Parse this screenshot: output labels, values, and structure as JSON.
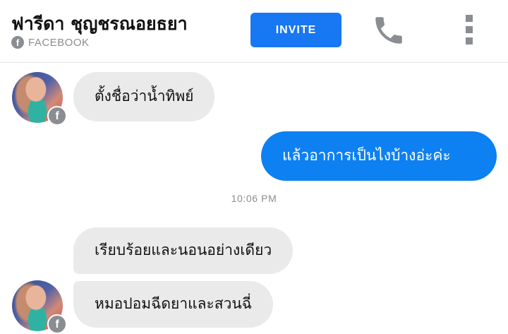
{
  "header": {
    "contact_name": "ฟารีดา ชุญชรณอยธยา",
    "source_label": "FACEBOOK",
    "source_icon": "facebook-icon",
    "invite_label": "INVITE",
    "call_icon": "phone-icon",
    "more_icon": "more-vertical-icon"
  },
  "messages": [
    {
      "direction": "incoming",
      "text": "ตั้งชื่อว่าน้ำทิพย์"
    },
    {
      "direction": "outgoing",
      "text": "แล้วอาการเป็นไงบ้างอ่ะค่ะ"
    },
    {
      "direction": "incoming",
      "text": "เรียบร้อยและนอนอย่างเดียว"
    },
    {
      "direction": "incoming",
      "text": "หมอปอมฉีดยาและสวนฉี่"
    }
  ],
  "timestamp": "10:06 PM",
  "colors": {
    "accent": "#1877f2",
    "outgoing_bubble": "#0d80f2",
    "incoming_bubble": "#eaeaea",
    "muted": "#8a8d91"
  }
}
